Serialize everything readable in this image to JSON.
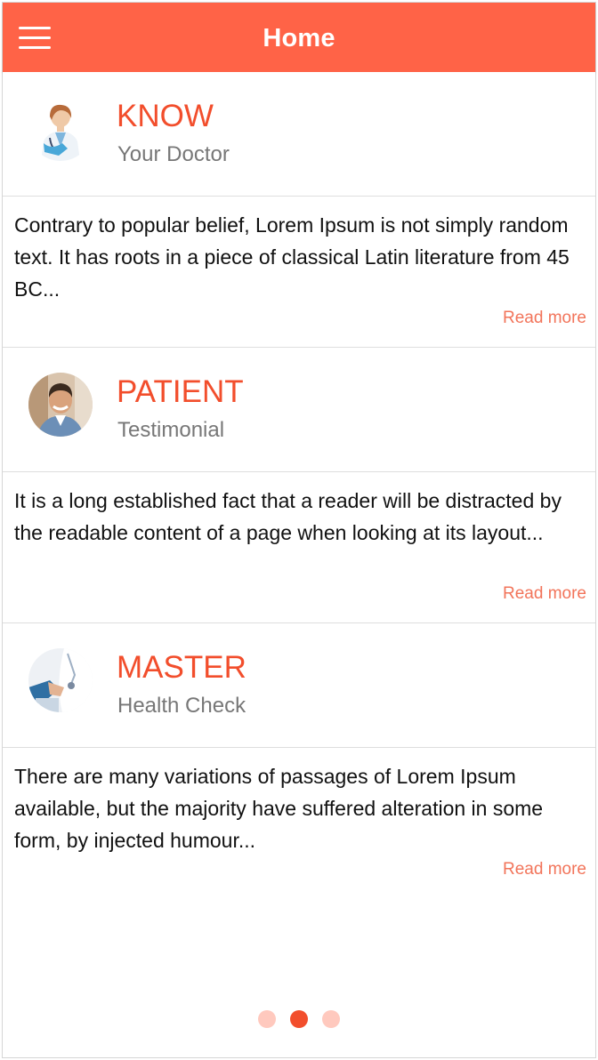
{
  "header": {
    "title": "Home",
    "menu_icon": "hamburger-menu-icon",
    "background_color": "#ff6347"
  },
  "cards": [
    {
      "title": "KNOW",
      "subtitle": "Your Doctor",
      "avatar": "doctor-avatar",
      "body": "Contrary to popular belief, Lorem Ipsum is not simply random text. It has roots in a piece of classical Latin literature from 45 BC...",
      "link": "Read more"
    },
    {
      "title": "PATIENT",
      "subtitle": "Testimonial",
      "avatar": "patient-avatar",
      "body": "It is a long established fact that a reader will be distracted by the readable content of a page when looking at its layout...",
      "link": "Read more"
    },
    {
      "title": "MASTER",
      "subtitle": "Health Check",
      "avatar": "health-check-avatar",
      "body": "There are many variations of passages of Lorem Ipsum available, but the majority have suffered alteration in some form, by injected humour...",
      "link": "Read more"
    }
  ],
  "pager": {
    "count": 3,
    "active_index": 1,
    "active_color": "#f24e2c",
    "inactive_color": "#ffc9be"
  },
  "accent_color": "#f24e2c",
  "link_color": "#f2745a"
}
